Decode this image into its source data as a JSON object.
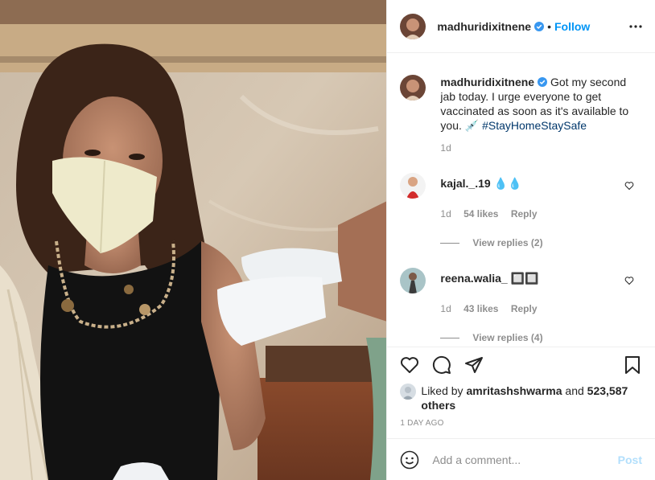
{
  "header": {
    "username": "madhuridixitnene",
    "separator": "•",
    "follow_label": "Follow",
    "verified_icon": "verified-badge-icon",
    "more_icon": "more-options-icon"
  },
  "caption": {
    "username": "madhuridixitnene",
    "text": " Got my second jab today. I urge everyone to get vaccinated as soon as it's available to you. 💉 ",
    "hashtag": "#StayHomeStaySafe",
    "time": "1d"
  },
  "comments": [
    {
      "username": "kajal._.19",
      "text": "💧💧",
      "time": "1d",
      "likes": "54 likes",
      "reply_label": "Reply",
      "view_replies": "View replies (2)"
    },
    {
      "username": "reena.walia_",
      "text": "🔲🔲",
      "time": "1d",
      "likes": "43 likes",
      "reply_label": "Reply",
      "view_replies": "View replies (4)"
    }
  ],
  "liked_by": {
    "prefix": "Liked by ",
    "user": "amritashshwarma",
    "and": " and ",
    "others": "523,587 others"
  },
  "post_age": "1 DAY AGO",
  "add_comment": {
    "placeholder": "Add a comment...",
    "post_label": "Post"
  },
  "colors": {
    "accent": "#0095f6",
    "post_disabled": "#b2dffc",
    "hashtag": "#00376b",
    "muted": "#8e8e8e"
  }
}
